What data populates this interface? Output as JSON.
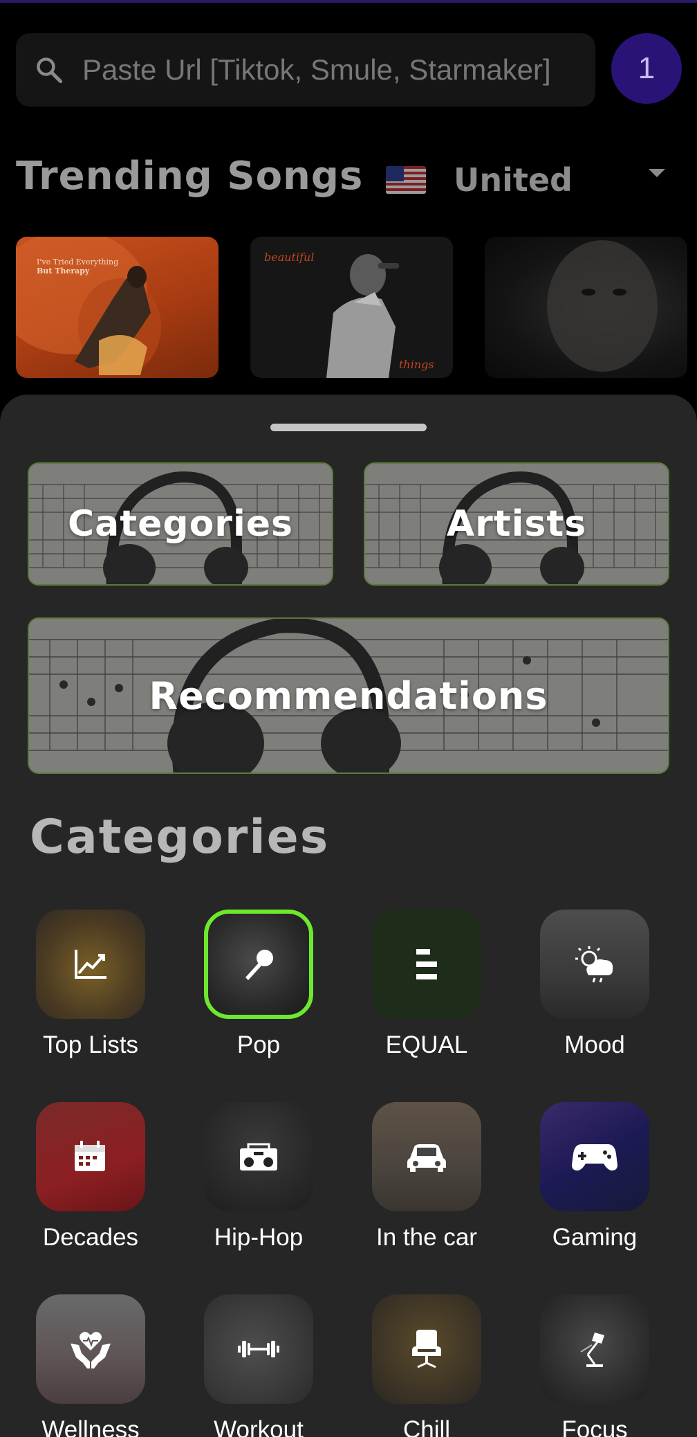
{
  "search": {
    "placeholder": "Paste Url [Tiktok, Smule, Starmaker]",
    "icon": "search-icon"
  },
  "badge": {
    "count": "1",
    "color": "#2a1377"
  },
  "trending": {
    "title": "Trending Songs",
    "country": "United",
    "thumbnails": [
      {
        "art_text_1": "I've Tried Everything",
        "art_text_2": "But Therapy"
      },
      {
        "art_text_1": "beautiful",
        "art_text_2": "things"
      },
      {
        "art_text_1": "",
        "art_text_2": ""
      }
    ]
  },
  "sheet": {
    "cards": {
      "categories": "Categories",
      "artists": "Artists",
      "recommendations": "Recommendations"
    },
    "categories_title": "Categories",
    "items": [
      {
        "label": "Top Lists",
        "icon": "chart-line-icon"
      },
      {
        "label": "Pop",
        "icon": "microphone-icon",
        "selected": true
      },
      {
        "label": "EQUAL",
        "icon": "equal-bars-icon"
      },
      {
        "label": "Mood",
        "icon": "weather-icon"
      },
      {
        "label": "Decades",
        "icon": "calendar-icon"
      },
      {
        "label": "Hip-Hop",
        "icon": "boombox-icon"
      },
      {
        "label": "In the car",
        "icon": "car-icon"
      },
      {
        "label": "Gaming",
        "icon": "gamepad-icon"
      },
      {
        "label": "Wellness",
        "icon": "heart-hands-icon"
      },
      {
        "label": "Workout",
        "icon": "dumbbell-icon"
      },
      {
        "label": "Chill",
        "icon": "armchair-icon"
      },
      {
        "label": "Focus",
        "icon": "desk-lamp-icon"
      }
    ]
  },
  "colors": {
    "accent_selected": "#6ee82f",
    "card_border": "#5c7a3c",
    "sheet_bg": "#262626"
  }
}
